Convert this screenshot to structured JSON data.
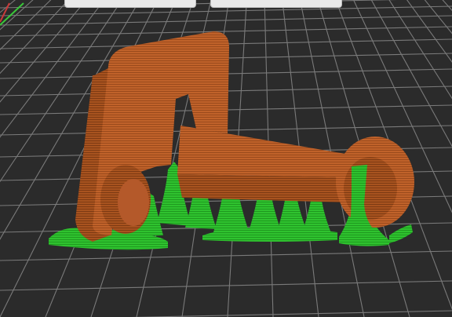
{
  "app": {
    "view": "3d-slice-preview",
    "colors": {
      "background": "#2b2b2b",
      "grid_line": "#7a7a7a",
      "bed_axis_x": "#c83a3a",
      "bed_axis_y": "#3ac83a",
      "model_layers": "#c0622a",
      "model_layers_dark": "#9a4a1c",
      "model_layers_light": "#d8783a",
      "support_material": "#2fc22f",
      "support_material_dark": "#1f9a1f"
    },
    "icons": [
      "view-toolbar-button-left",
      "view-toolbar-button-right"
    ]
  }
}
